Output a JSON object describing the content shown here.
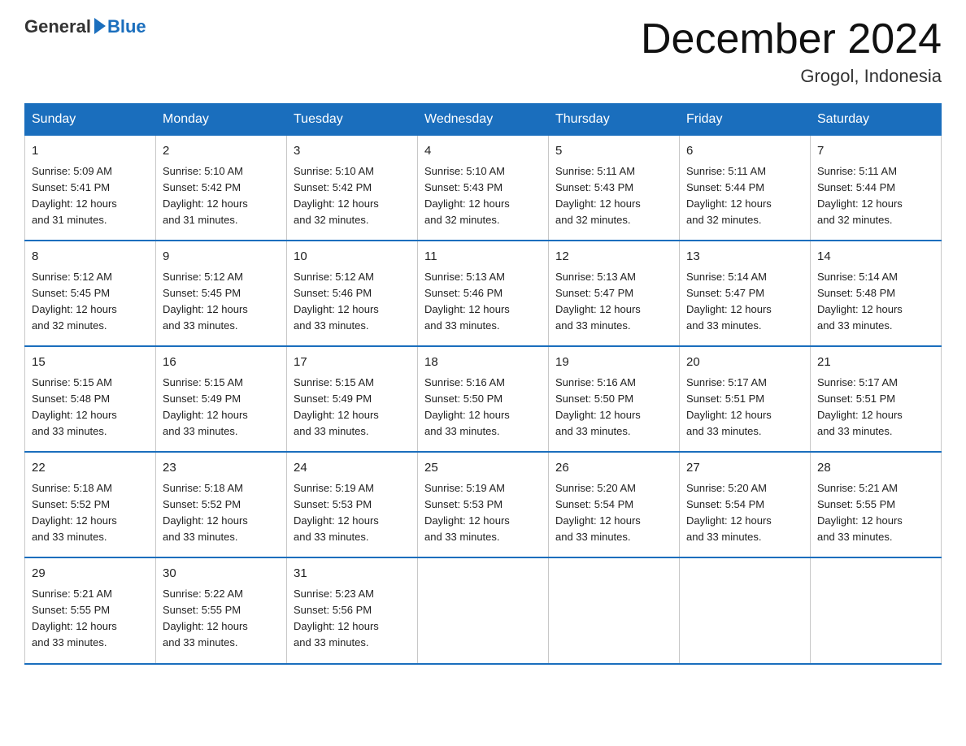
{
  "header": {
    "logo_general": "General",
    "logo_blue": "Blue",
    "month_title": "December 2024",
    "location": "Grogol, Indonesia"
  },
  "days_of_week": [
    "Sunday",
    "Monday",
    "Tuesday",
    "Wednesday",
    "Thursday",
    "Friday",
    "Saturday"
  ],
  "weeks": [
    [
      {
        "day": "1",
        "sunrise": "5:09 AM",
        "sunset": "5:41 PM",
        "daylight": "12 hours and 31 minutes."
      },
      {
        "day": "2",
        "sunrise": "5:10 AM",
        "sunset": "5:42 PM",
        "daylight": "12 hours and 31 minutes."
      },
      {
        "day": "3",
        "sunrise": "5:10 AM",
        "sunset": "5:42 PM",
        "daylight": "12 hours and 32 minutes."
      },
      {
        "day": "4",
        "sunrise": "5:10 AM",
        "sunset": "5:43 PM",
        "daylight": "12 hours and 32 minutes."
      },
      {
        "day": "5",
        "sunrise": "5:11 AM",
        "sunset": "5:43 PM",
        "daylight": "12 hours and 32 minutes."
      },
      {
        "day": "6",
        "sunrise": "5:11 AM",
        "sunset": "5:44 PM",
        "daylight": "12 hours and 32 minutes."
      },
      {
        "day": "7",
        "sunrise": "5:11 AM",
        "sunset": "5:44 PM",
        "daylight": "12 hours and 32 minutes."
      }
    ],
    [
      {
        "day": "8",
        "sunrise": "5:12 AM",
        "sunset": "5:45 PM",
        "daylight": "12 hours and 32 minutes."
      },
      {
        "day": "9",
        "sunrise": "5:12 AM",
        "sunset": "5:45 PM",
        "daylight": "12 hours and 33 minutes."
      },
      {
        "day": "10",
        "sunrise": "5:12 AM",
        "sunset": "5:46 PM",
        "daylight": "12 hours and 33 minutes."
      },
      {
        "day": "11",
        "sunrise": "5:13 AM",
        "sunset": "5:46 PM",
        "daylight": "12 hours and 33 minutes."
      },
      {
        "day": "12",
        "sunrise": "5:13 AM",
        "sunset": "5:47 PM",
        "daylight": "12 hours and 33 minutes."
      },
      {
        "day": "13",
        "sunrise": "5:14 AM",
        "sunset": "5:47 PM",
        "daylight": "12 hours and 33 minutes."
      },
      {
        "day": "14",
        "sunrise": "5:14 AM",
        "sunset": "5:48 PM",
        "daylight": "12 hours and 33 minutes."
      }
    ],
    [
      {
        "day": "15",
        "sunrise": "5:15 AM",
        "sunset": "5:48 PM",
        "daylight": "12 hours and 33 minutes."
      },
      {
        "day": "16",
        "sunrise": "5:15 AM",
        "sunset": "5:49 PM",
        "daylight": "12 hours and 33 minutes."
      },
      {
        "day": "17",
        "sunrise": "5:15 AM",
        "sunset": "5:49 PM",
        "daylight": "12 hours and 33 minutes."
      },
      {
        "day": "18",
        "sunrise": "5:16 AM",
        "sunset": "5:50 PM",
        "daylight": "12 hours and 33 minutes."
      },
      {
        "day": "19",
        "sunrise": "5:16 AM",
        "sunset": "5:50 PM",
        "daylight": "12 hours and 33 minutes."
      },
      {
        "day": "20",
        "sunrise": "5:17 AM",
        "sunset": "5:51 PM",
        "daylight": "12 hours and 33 minutes."
      },
      {
        "day": "21",
        "sunrise": "5:17 AM",
        "sunset": "5:51 PM",
        "daylight": "12 hours and 33 minutes."
      }
    ],
    [
      {
        "day": "22",
        "sunrise": "5:18 AM",
        "sunset": "5:52 PM",
        "daylight": "12 hours and 33 minutes."
      },
      {
        "day": "23",
        "sunrise": "5:18 AM",
        "sunset": "5:52 PM",
        "daylight": "12 hours and 33 minutes."
      },
      {
        "day": "24",
        "sunrise": "5:19 AM",
        "sunset": "5:53 PM",
        "daylight": "12 hours and 33 minutes."
      },
      {
        "day": "25",
        "sunrise": "5:19 AM",
        "sunset": "5:53 PM",
        "daylight": "12 hours and 33 minutes."
      },
      {
        "day": "26",
        "sunrise": "5:20 AM",
        "sunset": "5:54 PM",
        "daylight": "12 hours and 33 minutes."
      },
      {
        "day": "27",
        "sunrise": "5:20 AM",
        "sunset": "5:54 PM",
        "daylight": "12 hours and 33 minutes."
      },
      {
        "day": "28",
        "sunrise": "5:21 AM",
        "sunset": "5:55 PM",
        "daylight": "12 hours and 33 minutes."
      }
    ],
    [
      {
        "day": "29",
        "sunrise": "5:21 AM",
        "sunset": "5:55 PM",
        "daylight": "12 hours and 33 minutes."
      },
      {
        "day": "30",
        "sunrise": "5:22 AM",
        "sunset": "5:55 PM",
        "daylight": "12 hours and 33 minutes."
      },
      {
        "day": "31",
        "sunrise": "5:23 AM",
        "sunset": "5:56 PM",
        "daylight": "12 hours and 33 minutes."
      },
      null,
      null,
      null,
      null
    ]
  ],
  "labels": {
    "sunrise": "Sunrise:",
    "sunset": "Sunset:",
    "daylight": "Daylight:"
  }
}
